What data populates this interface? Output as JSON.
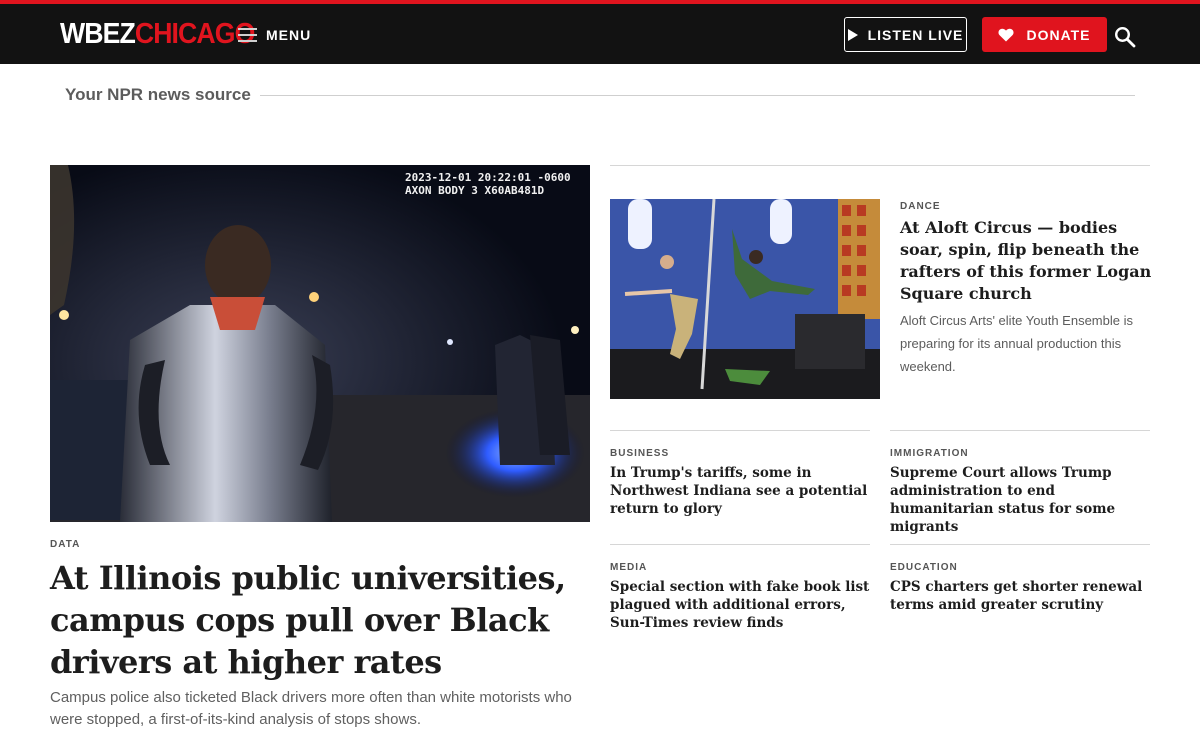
{
  "header": {
    "logo_wbez": "WBEZ",
    "logo_chicago": "CHICAGO",
    "menu_label": "MENU",
    "listen_label": "LISTEN LIVE",
    "donate_label": "DONATE",
    "brand_color": "#e0141e",
    "icons": [
      "hamburger-icon",
      "play-icon",
      "heart-icon",
      "search-icon"
    ]
  },
  "tagline": "Your NPR news source",
  "hero": {
    "image_stamp": "2023-12-01 20:22:01 -0600\nAXON BODY 3 X60AB481D",
    "kicker": "DATA",
    "title": "At Illinois public universities, campus cops pull over Black drivers at higher rates",
    "dek": "Campus police also ticketed Black drivers more often than white motorists who were stopped, a first-of-its-kind analysis of stops shows."
  },
  "feature": {
    "kicker": "DANCE",
    "title": "At Aloft Circus — bodies soar, spin, flip beneath the rafters of this former Logan Square church",
    "dek": "Aloft Circus Arts' elite Youth Ensemble is preparing for its annual production this weekend."
  },
  "stories": [
    {
      "kicker": "BUSINESS",
      "title": "In Trump's tariffs, some in Northwest Indiana see a potential return to glory"
    },
    {
      "kicker": "IMMIGRATION",
      "title": "Supreme Court allows Trump administration to end humanitarian status for some migrants"
    },
    {
      "kicker": "MEDIA",
      "title": "Special section with fake book list plagued with additional errors, Sun-Times review finds"
    },
    {
      "kicker": "EDUCATION",
      "title": "CPS charters get shorter renewal terms amid greater scrutiny"
    }
  ]
}
